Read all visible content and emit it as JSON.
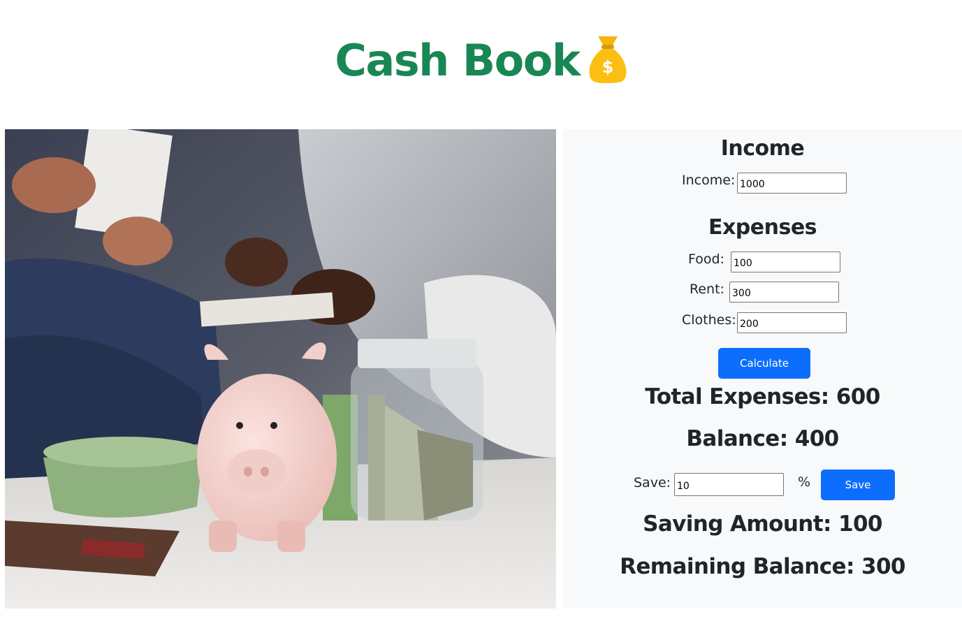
{
  "header": {
    "title": "Cash Book",
    "icon": "money-bag-icon",
    "title_color": "#198754"
  },
  "income": {
    "heading": "Income",
    "label": "Income:",
    "value": "1000"
  },
  "expenses": {
    "heading": "Expenses",
    "food_label": "Food:",
    "food_value": "100",
    "rent_label": "Rent:",
    "rent_value": "300",
    "clothes_label": "Clothes:",
    "clothes_value": "200",
    "calculate_label": "Calculate"
  },
  "totals": {
    "total_expenses_label": "Total Expenses:",
    "total_expenses_value": "600",
    "balance_label": "Balance:",
    "balance_value": "400"
  },
  "saving": {
    "label": "Save:",
    "value": "10",
    "percent_sign": "%",
    "save_label": "Save",
    "saving_amount_label": "Saving Amount:",
    "saving_amount_value": "100",
    "remaining_label": "Remaining Balance:",
    "remaining_value": "300"
  },
  "colors": {
    "accent": "#0d6efd",
    "brand": "#198754",
    "panel_bg": "#f8f9fa"
  }
}
